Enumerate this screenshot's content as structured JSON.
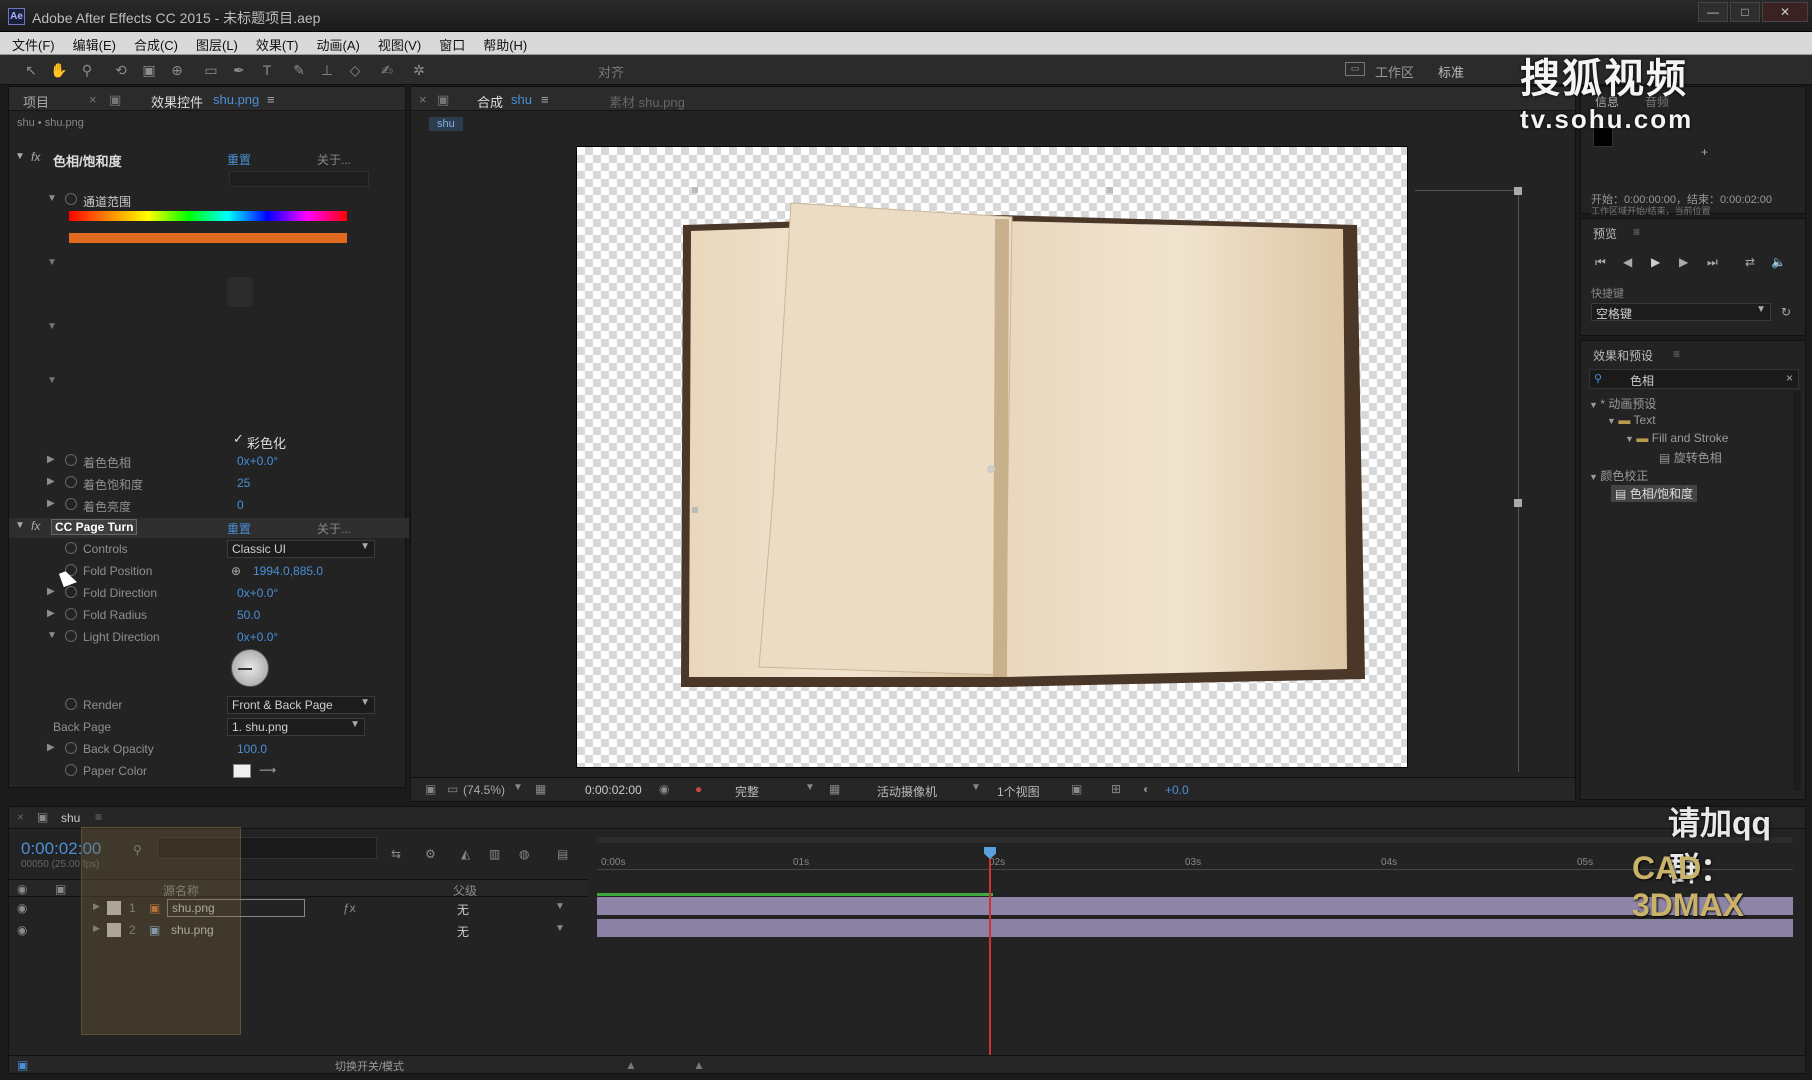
{
  "app": {
    "title": "Adobe After Effects CC 2015 - 未标题项目.aep",
    "logo": "Ae"
  },
  "window_controls": {
    "minimize": "—",
    "maximize": "□",
    "close": "✕"
  },
  "menu": [
    "文件(F)",
    "编辑(E)",
    "合成(C)",
    "图层(L)",
    "效果(T)",
    "动画(A)",
    "视图(V)",
    "窗口",
    "帮助(H)"
  ],
  "toolbar": {
    "align_label": "对齐",
    "workspace_label": "工作区",
    "workspace_value": "标准"
  },
  "effects_panel": {
    "tab_project": "项目",
    "tab_label": "效果控件",
    "tab_layer": "shu.png",
    "layer_path": "shu • shu.png",
    "fx1": {
      "name": "色相/饱和度",
      "reset": "重置",
      "about": "关于..."
    },
    "channel_range": "通道范围",
    "colorize_check": "✓",
    "colorize_label": "彩色化",
    "colorize_hue": {
      "name": "着色色相",
      "value": "0x+0.0°"
    },
    "colorize_sat": {
      "name": "着色饱和度",
      "value": "25"
    },
    "colorize_light": {
      "name": "着色亮度",
      "value": "0"
    },
    "fx2": {
      "name": "CC Page Turn",
      "reset": "重置",
      "about": "关于..."
    },
    "controls": {
      "name": "Controls",
      "value": "Classic UI"
    },
    "fold_position": {
      "name": "Fold Position",
      "value": "1994.0,885.0"
    },
    "fold_direction": {
      "name": "Fold Direction",
      "value": "0x+0.0°"
    },
    "fold_radius": {
      "name": "Fold Radius",
      "value": "50.0"
    },
    "light_direction": {
      "name": "Light Direction",
      "value": "0x+0.0°"
    },
    "renderer": {
      "name": "Render",
      "value": "Front & Back Page"
    },
    "back_page": {
      "name": "Back Page",
      "value": "1. shu.png"
    },
    "back_opacity": {
      "name": "Back Opacity",
      "value": "100.0"
    },
    "paper_color": {
      "name": "Paper Color"
    }
  },
  "comp_panel": {
    "tab_label": "合成",
    "tab_comp": "shu",
    "tab_footage": "素材 shu.png",
    "crumb": "shu",
    "zoom": "(74.5%)",
    "timecode": "0:00:02:00",
    "quality": "完整",
    "camera": "活动摄像机",
    "views": "1个视图",
    "exposure": "+0.0"
  },
  "info_panel": {
    "tab_info": "信息",
    "tab_audio": "音频",
    "start_line": "开始：0:00:00:00，结束：0:00:02:00",
    "sub_line": "工作区域开始/结束，当前位置"
  },
  "preview_panel": {
    "title": "预览",
    "shortcut_label": "快捷键",
    "shortcut_value": "空格键"
  },
  "effects_presets": {
    "title": "效果和预设",
    "search": "色相",
    "tree": [
      {
        "label": "* 动画预设",
        "indent": 0
      },
      {
        "label": "Text",
        "indent": 1
      },
      {
        "label": "Fill and Stroke",
        "indent": 2
      },
      {
        "label": "旋转色相",
        "indent": 3
      },
      {
        "label": "颜色校正",
        "indent": 0
      },
      {
        "label": "色相/饱和度",
        "indent": 1,
        "selected": true
      }
    ]
  },
  "timeline": {
    "comp_name": "shu",
    "timecode": "0:00:02:00",
    "fps": "00050 (25.00 fps)",
    "col_source": "源名称",
    "col_parent": "父级",
    "rulers": [
      "0:00s",
      "01s",
      "02s",
      "03s",
      "04s",
      "05s"
    ],
    "layers": [
      {
        "num": "1",
        "name": "shu.png",
        "parent": "无"
      },
      {
        "num": "2",
        "name": "shu.png",
        "parent": "无"
      }
    ],
    "footer": "切换开关/模式"
  },
  "watermark": {
    "brand": "搜狐视频",
    "url": "tv.sohu.com",
    "qq": "请加qq群：",
    "cad": "CAD 3DMAX"
  }
}
